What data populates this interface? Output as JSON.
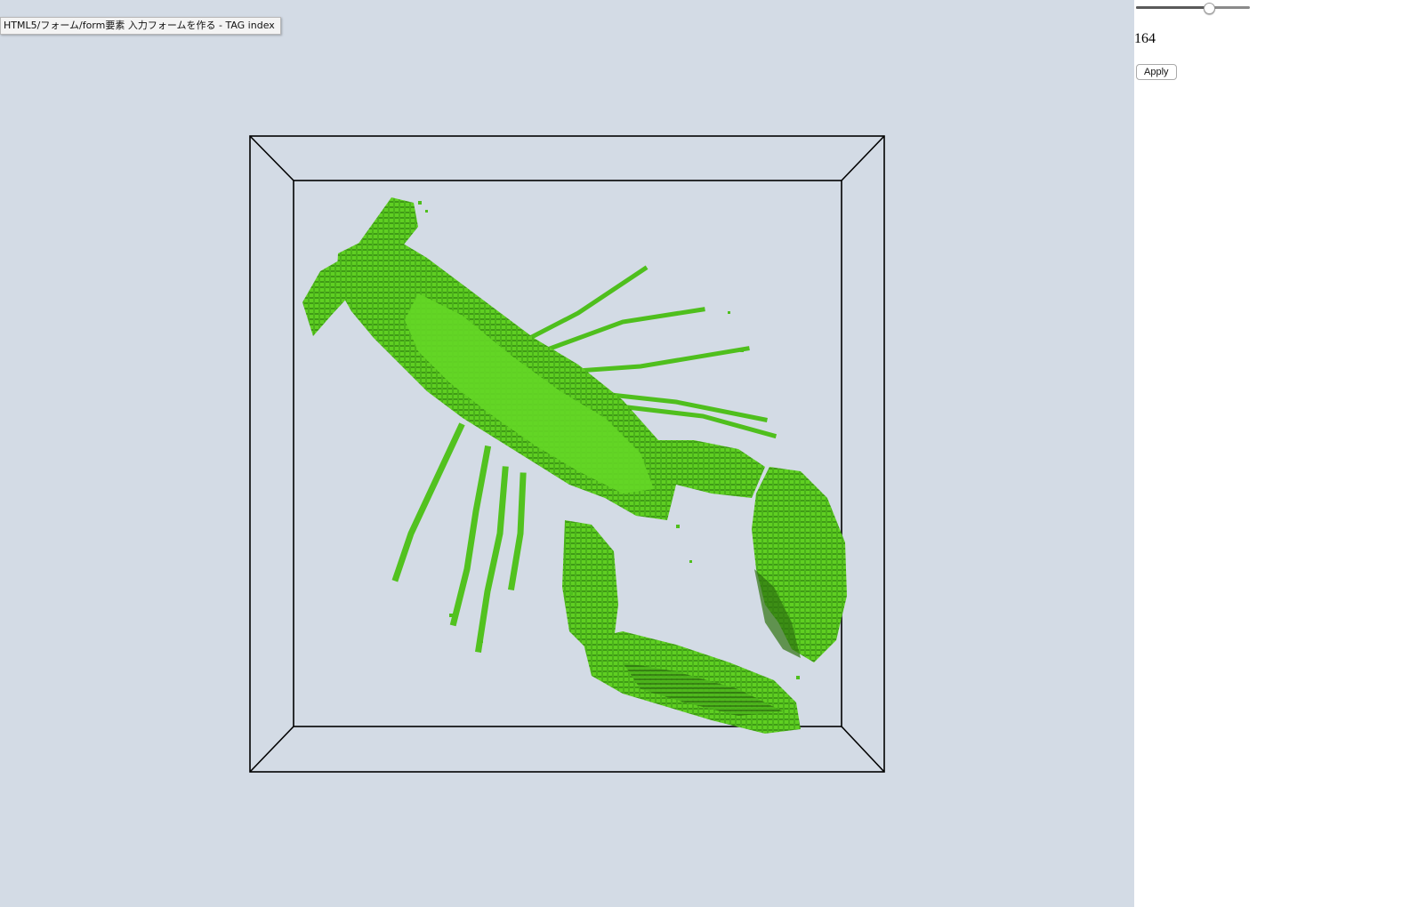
{
  "tooltip": {
    "text": "HTML5/フォーム/form要素 入力フォームを作る - TAG index"
  },
  "controls": {
    "slider": {
      "value": 164,
      "min": 0,
      "max": 255
    },
    "value_text": "164",
    "apply_label": "Apply"
  },
  "scene": {
    "background_color": "#d3dbe5",
    "model_color": "#5fcf22",
    "model_shadow_color": "#2f7410",
    "box_color": "#000000",
    "subject": "lobster-voxel-model"
  }
}
